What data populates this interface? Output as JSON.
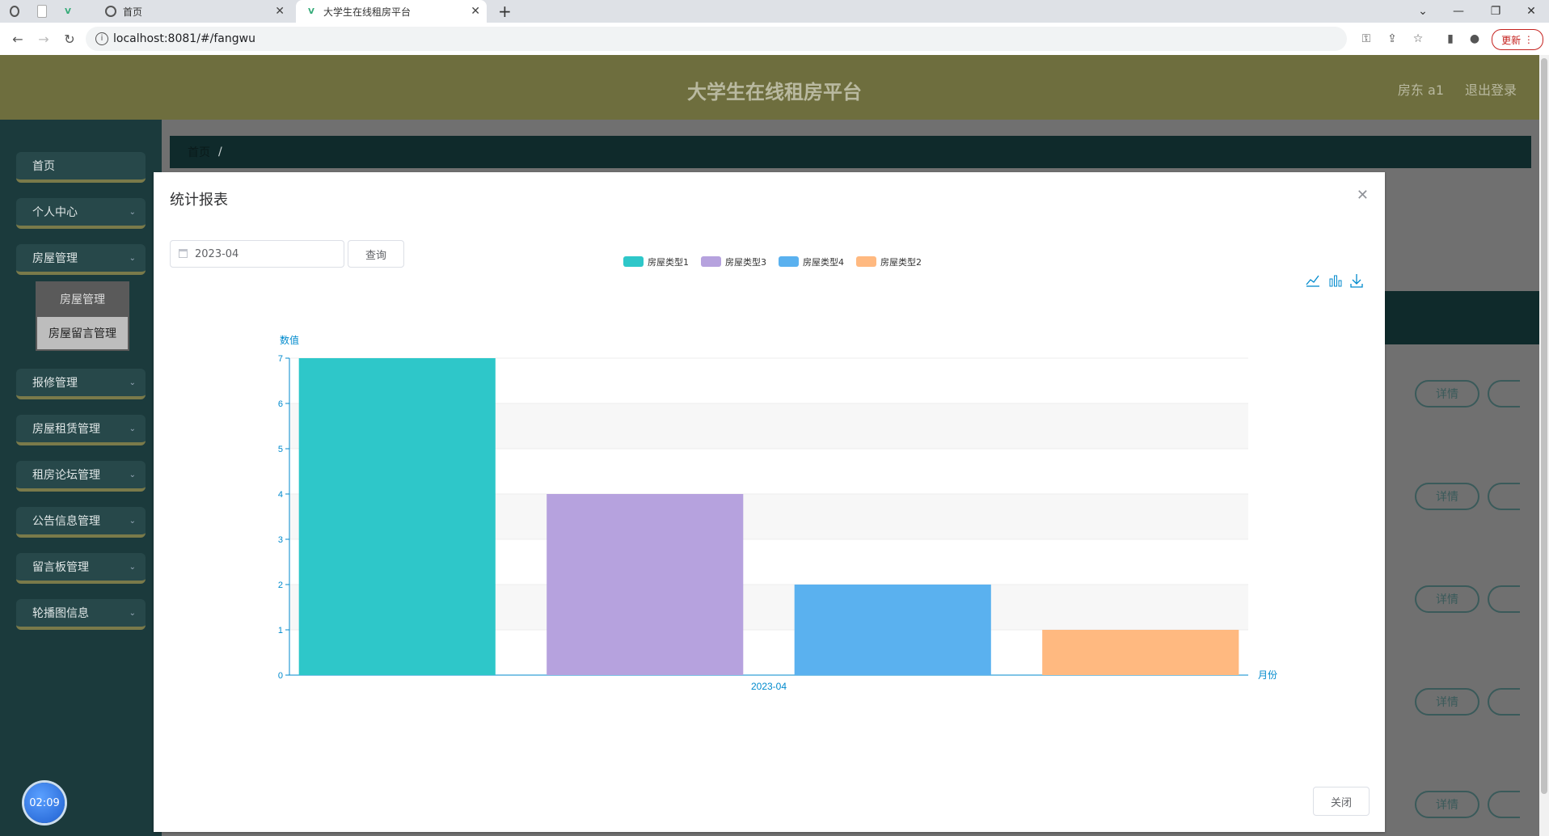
{
  "browser": {
    "tabs": [
      {
        "title": "首页",
        "active": false
      },
      {
        "title": "大学生在线租房平台",
        "active": true
      }
    ],
    "url": "localhost:8081/#/fangwu",
    "update_label": "更新"
  },
  "header": {
    "title": "大学生在线租房平台",
    "user": "房东 a1",
    "logout": "退出登录"
  },
  "sidebar": {
    "items": [
      {
        "label": "首页",
        "has_children": false
      },
      {
        "label": "个人中心",
        "has_children": true
      },
      {
        "label": "房屋管理",
        "has_children": true
      },
      {
        "label": "报修管理",
        "has_children": true
      },
      {
        "label": "房屋租赁管理",
        "has_children": true
      },
      {
        "label": "租房论坛管理",
        "has_children": true
      },
      {
        "label": "公告信息管理",
        "has_children": true
      },
      {
        "label": "留言板管理",
        "has_children": true
      },
      {
        "label": "轮播图信息",
        "has_children": true
      }
    ],
    "submenu": [
      "房屋管理",
      "房屋留言管理"
    ]
  },
  "breadcrumb": {
    "home": "首页",
    "sep": "/"
  },
  "rows": {
    "detail_label": "详情"
  },
  "clock": "02:09",
  "dialog": {
    "title": "统计报表",
    "date_value": "2023-04",
    "query_label": "查询",
    "close_label": "关闭"
  },
  "chart_data": {
    "type": "bar",
    "categories": [
      "2023-04"
    ],
    "series": [
      {
        "name": "房屋类型1",
        "values": [
          7
        ],
        "color": "#2ec7c9"
      },
      {
        "name": "房屋类型3",
        "values": [
          4
        ],
        "color": "#b6a2de"
      },
      {
        "name": "房屋类型4",
        "values": [
          2
        ],
        "color": "#5ab1ef"
      },
      {
        "name": "房屋类型2",
        "values": [
          1
        ],
        "color": "#ffb980"
      }
    ],
    "xlabel": "月份",
    "ylabel": "数值",
    "ylim": [
      0,
      7
    ],
    "yticks": [
      0,
      1,
      2,
      3,
      4,
      5,
      6,
      7
    ],
    "legend": "top-center",
    "grid": true,
    "axis_color": "#008acd"
  }
}
